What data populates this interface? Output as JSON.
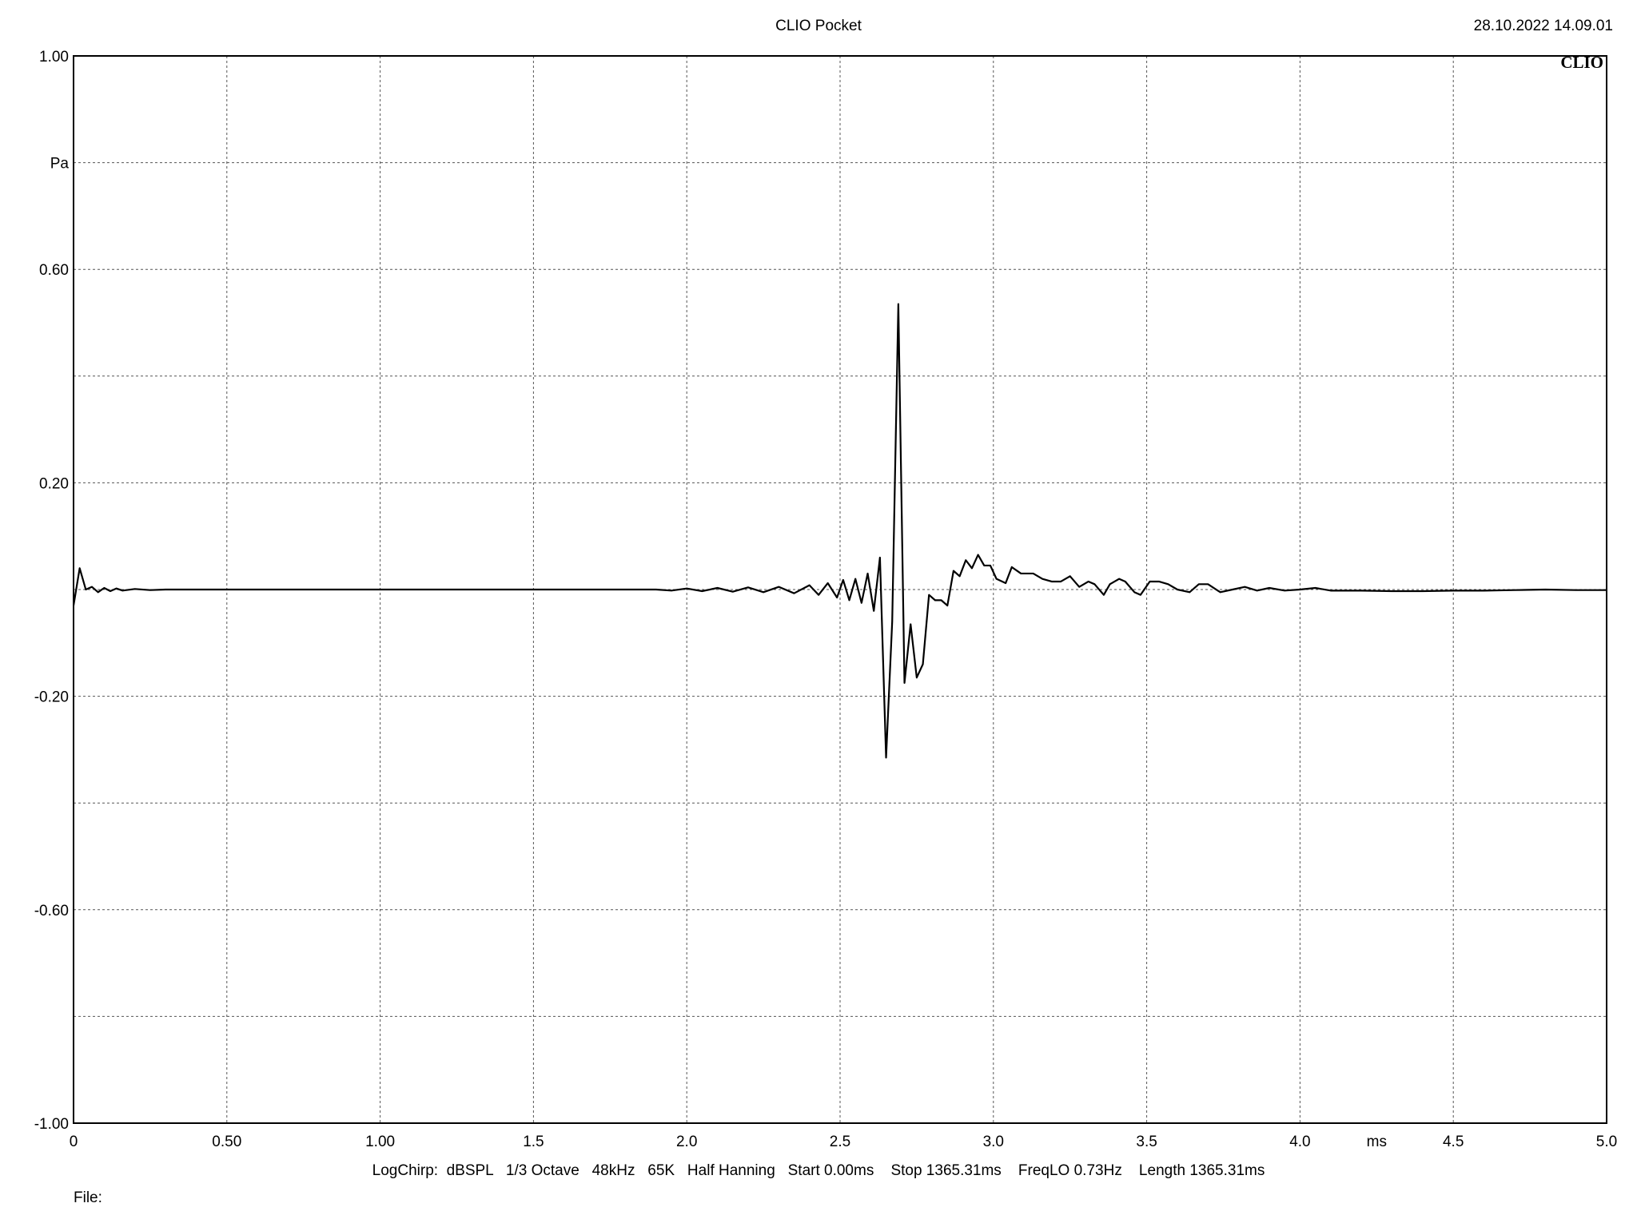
{
  "header": {
    "title": "CLIO Pocket",
    "timestamp": "28.10.2022 14.09.01",
    "brand": "CLIO"
  },
  "footer": {
    "info": "LogChirp:  dBSPL   1/3 Octave   48kHz   65K   Half Hanning   Start 0.00ms    Stop 1365.31ms    FreqLO 0.73Hz    Length 1365.31ms",
    "file_label": "File:"
  },
  "colors": {
    "trace": "#000000",
    "grid": "#555555",
    "frame": "#000000",
    "background": "#ffffff"
  },
  "chart_data": {
    "type": "line",
    "title": "CLIO Pocket",
    "xlabel": "ms",
    "ylabel": "Pa",
    "xlim": [
      0,
      5.0
    ],
    "ylim": [
      -1.0,
      1.0
    ],
    "grid": true,
    "x_ticks": [
      {
        "value": 0,
        "label": "0"
      },
      {
        "value": 0.5,
        "label": "0.50"
      },
      {
        "value": 1.0,
        "label": "1.00"
      },
      {
        "value": 1.5,
        "label": "1.5"
      },
      {
        "value": 2.0,
        "label": "2.0"
      },
      {
        "value": 2.5,
        "label": "2.5"
      },
      {
        "value": 3.0,
        "label": "3.0"
      },
      {
        "value": 3.5,
        "label": "3.5"
      },
      {
        "value": 4.0,
        "label": "4.0"
      },
      {
        "value": 4.5,
        "label": "4.5"
      },
      {
        "value": 5.0,
        "label": "5.0"
      }
    ],
    "y_ticks": [
      {
        "value": 1.0,
        "label": "1.00"
      },
      {
        "value": 0.6,
        "label": "0.60"
      },
      {
        "value": 0.2,
        "label": "0.20"
      },
      {
        "value": -0.2,
        "label": "-0.20"
      },
      {
        "value": -0.6,
        "label": "-0.60"
      },
      {
        "value": -1.0,
        "label": "-1.00"
      }
    ],
    "x_unit_label": {
      "value": 4.25,
      "label": "ms"
    },
    "y_unit_label": {
      "value": 0.8,
      "label": "Pa"
    },
    "series": [
      {
        "points": [
          [
            0.0,
            -0.03
          ],
          [
            0.02,
            0.04
          ],
          [
            0.04,
            0.0
          ],
          [
            0.06,
            0.005
          ],
          [
            0.08,
            -0.005
          ],
          [
            0.1,
            0.003
          ],
          [
            0.12,
            -0.003
          ],
          [
            0.14,
            0.002
          ],
          [
            0.16,
            -0.002
          ],
          [
            0.2,
            0.001
          ],
          [
            0.25,
            -0.001
          ],
          [
            0.3,
            0.0
          ],
          [
            0.4,
            0.0
          ],
          [
            1.0,
            0.0
          ],
          [
            1.5,
            0.0
          ],
          [
            1.9,
            0.0
          ],
          [
            1.95,
            -0.002
          ],
          [
            2.0,
            0.002
          ],
          [
            2.05,
            -0.003
          ],
          [
            2.1,
            0.003
          ],
          [
            2.15,
            -0.004
          ],
          [
            2.2,
            0.004
          ],
          [
            2.25,
            -0.005
          ],
          [
            2.3,
            0.005
          ],
          [
            2.35,
            -0.007
          ],
          [
            2.4,
            0.008
          ],
          [
            2.43,
            -0.01
          ],
          [
            2.46,
            0.012
          ],
          [
            2.49,
            -0.015
          ],
          [
            2.51,
            0.018
          ],
          [
            2.53,
            -0.02
          ],
          [
            2.55,
            0.02
          ],
          [
            2.57,
            -0.025
          ],
          [
            2.59,
            0.03
          ],
          [
            2.61,
            -0.04
          ],
          [
            2.63,
            0.06
          ],
          [
            2.65,
            -0.315
          ],
          [
            2.67,
            -0.06
          ],
          [
            2.69,
            0.535
          ],
          [
            2.71,
            -0.175
          ],
          [
            2.73,
            -0.065
          ],
          [
            2.75,
            -0.165
          ],
          [
            2.77,
            -0.14
          ],
          [
            2.79,
            -0.01
          ],
          [
            2.81,
            -0.02
          ],
          [
            2.83,
            -0.02
          ],
          [
            2.85,
            -0.03
          ],
          [
            2.87,
            0.035
          ],
          [
            2.89,
            0.025
          ],
          [
            2.91,
            0.055
          ],
          [
            2.93,
            0.04
          ],
          [
            2.95,
            0.065
          ],
          [
            2.97,
            0.045
          ],
          [
            2.99,
            0.045
          ],
          [
            3.01,
            0.02
          ],
          [
            3.04,
            0.012
          ],
          [
            3.06,
            0.042
          ],
          [
            3.09,
            0.03
          ],
          [
            3.13,
            0.03
          ],
          [
            3.16,
            0.02
          ],
          [
            3.19,
            0.015
          ],
          [
            3.22,
            0.015
          ],
          [
            3.25,
            0.025
          ],
          [
            3.28,
            0.005
          ],
          [
            3.31,
            0.015
          ],
          [
            3.33,
            0.01
          ],
          [
            3.36,
            -0.01
          ],
          [
            3.38,
            0.01
          ],
          [
            3.41,
            0.02
          ],
          [
            3.43,
            0.015
          ],
          [
            3.46,
            -0.005
          ],
          [
            3.48,
            -0.01
          ],
          [
            3.51,
            0.015
          ],
          [
            3.54,
            0.015
          ],
          [
            3.57,
            0.01
          ],
          [
            3.6,
            0.0
          ],
          [
            3.64,
            -0.005
          ],
          [
            3.67,
            0.01
          ],
          [
            3.7,
            0.01
          ],
          [
            3.74,
            -0.005
          ],
          [
            3.78,
            0.0
          ],
          [
            3.82,
            0.005
          ],
          [
            3.86,
            -0.002
          ],
          [
            3.9,
            0.003
          ],
          [
            3.95,
            -0.002
          ],
          [
            4.0,
            0.0
          ],
          [
            4.05,
            0.003
          ],
          [
            4.1,
            -0.002
          ],
          [
            4.2,
            -0.002
          ],
          [
            4.3,
            -0.003
          ],
          [
            4.4,
            -0.003
          ],
          [
            4.5,
            -0.002
          ],
          [
            4.6,
            -0.002
          ],
          [
            4.7,
            -0.001
          ],
          [
            4.8,
            0.0
          ],
          [
            4.9,
            -0.001
          ],
          [
            5.0,
            -0.001
          ]
        ]
      }
    ]
  }
}
